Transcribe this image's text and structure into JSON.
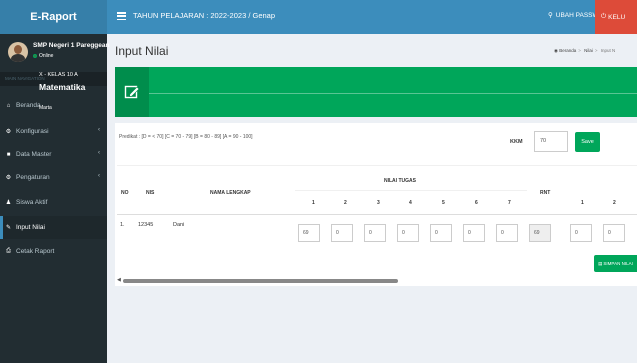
{
  "header": {
    "app_title": "E-Raport",
    "tahun": "TAHUN PELAJARAN : 2022-2023 / Genap",
    "ubah_password": "UBAH PASSWORD",
    "keluar": "KELU"
  },
  "sidebar": {
    "school_name": "SMP Negeri 1 Pareggean",
    "status": "Online",
    "nav_label": "MAIN NAVIGATION",
    "items": [
      {
        "label": "Beranda",
        "icon": "home-icon"
      },
      {
        "label": "Konfigurasi",
        "icon": "cogs-icon"
      },
      {
        "label": "Data Master",
        "icon": "folder-icon"
      },
      {
        "label": "Pengaturan",
        "icon": "gear-icon"
      },
      {
        "label": "Siswa Aktif",
        "icon": "users-icon"
      },
      {
        "label": "Input Nilai",
        "icon": "edit-icon",
        "active": true
      },
      {
        "label": "Cetak Raport",
        "icon": "print-icon"
      }
    ]
  },
  "page": {
    "title": "Input Nilai",
    "breadcrumb": [
      "Beranda",
      "Nilai",
      "Input N"
    ]
  },
  "banner": {
    "kelas": "X - KELAS 10 A",
    "mapel": "Matematika",
    "guru": "Marta"
  },
  "form": {
    "predikat": "Predikat : [D = < 70] [C = 70 - 79] [B = 80 - 89] [A = 90 - 100]",
    "kkm_label": "KKM",
    "kkm_value": "70",
    "save_label": "Save",
    "simpan_label": "SIMPAN NILAI"
  },
  "table": {
    "headers": {
      "no": "NO",
      "nis": "NIS",
      "nama": "NAMA LENGKAP",
      "nilai_tugas": "NILAI TUGAS",
      "rnt": "RNT"
    },
    "tugas_cols": [
      "1",
      "2",
      "3",
      "4",
      "5",
      "6",
      "7"
    ],
    "extra_cols": [
      "1",
      "2"
    ],
    "rows": [
      {
        "no": "1.",
        "nis": "12345",
        "nama": "Dani",
        "tugas": [
          "69",
          "0",
          "0",
          "0",
          "0",
          "0",
          "0"
        ],
        "rnt": "69",
        "extra": [
          "0",
          "0"
        ]
      }
    ]
  },
  "colors": {
    "primary": "#3c8dbc",
    "green": "#00a65a",
    "danger": "#dd4b39",
    "sidebar": "#222d32"
  }
}
